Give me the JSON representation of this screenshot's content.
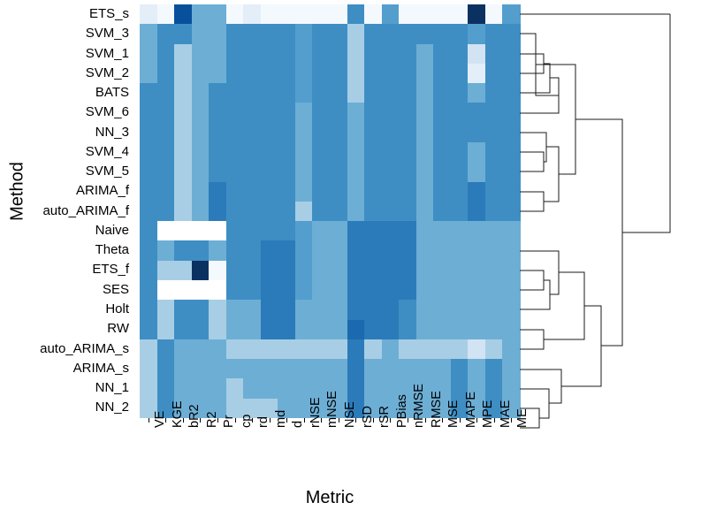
{
  "axes": {
    "y_title": "Method",
    "x_title": "Metric"
  },
  "chart_data": {
    "type": "heatmap",
    "title": "",
    "xlabel": "Metric",
    "ylabel": "Method",
    "grid": false,
    "legend": "none",
    "colorscale": {
      "name": "Blues",
      "stops": [
        "#f4f9fe",
        "#e3eef8",
        "#d2e3f3",
        "#a8cee5",
        "#8fc1de",
        "#6daed5",
        "#539ecd",
        "#3e8ec4",
        "#2b7bba",
        "#1b69af",
        "#08509b",
        "#0b3161"
      ],
      "na_color": "#ffffff"
    },
    "rows": [
      "ETS_s",
      "SVM_3",
      "SVM_1",
      "SVM_2",
      "BATS",
      "SVM_6",
      "NN_3",
      "SVM_4",
      "SVM_5",
      "ARIMA_f",
      "auto_ARIMA_f",
      "Naive",
      "Theta",
      "ETS_f",
      "SES",
      "Holt",
      "RW",
      "auto_ARIMA_s",
      "ARIMA_s",
      "NN_1",
      "NN_2"
    ],
    "columns": [
      "VE",
      "KGE",
      "bR2",
      "R2",
      "Pr",
      "cp",
      "rd",
      "md",
      "d",
      "rNSE",
      "mNSE",
      "NSE",
      "rSD",
      "rSR",
      "PBias",
      "nRMSE",
      "RMSE",
      "MSE",
      "MAPE",
      "MPE",
      "MAE",
      "ME"
    ],
    "cells": [
      [
        "#e3eef8",
        "#f4f9fe",
        "#08509b",
        "#6daed5",
        "#6daed5",
        "#f4f9fe",
        "#e3eef8",
        "#f4f9fe",
        "#f4f9fe",
        "#f4f9fe",
        "#f4f9fe",
        "#f4f9fe",
        "#3e8ec4",
        "#f4f9fe",
        "#539ecd",
        "#f4f9fe",
        "#f4f9fe",
        "#f4f9fe",
        "#f4f9fe",
        "#0b3161",
        "#f4f9fe",
        "#539ecd"
      ],
      [
        "#6daed5",
        "#3e8ec4",
        "#3e8ec4",
        "#6daed5",
        "#6daed5",
        "#3e8ec4",
        "#3e8ec4",
        "#3e8ec4",
        "#3e8ec4",
        "#539ecd",
        "#3e8ec4",
        "#3e8ec4",
        "#a8cee5",
        "#3e8ec4",
        "#3e8ec4",
        "#3e8ec4",
        "#3e8ec4",
        "#3e8ec4",
        "#3e8ec4",
        "#539ecd",
        "#3e8ec4",
        "#3e8ec4"
      ],
      [
        "#6daed5",
        "#3e8ec4",
        "#a8cee5",
        "#6daed5",
        "#6daed5",
        "#3e8ec4",
        "#3e8ec4",
        "#3e8ec4",
        "#3e8ec4",
        "#539ecd",
        "#3e8ec4",
        "#3e8ec4",
        "#a8cee5",
        "#3e8ec4",
        "#3e8ec4",
        "#3e8ec4",
        "#6daed5",
        "#3e8ec4",
        "#3e8ec4",
        "#d2e3f3",
        "#3e8ec4",
        "#3e8ec4"
      ],
      [
        "#6daed5",
        "#3e8ec4",
        "#a8cee5",
        "#6daed5",
        "#6daed5",
        "#3e8ec4",
        "#3e8ec4",
        "#3e8ec4",
        "#3e8ec4",
        "#539ecd",
        "#3e8ec4",
        "#3e8ec4",
        "#a8cee5",
        "#3e8ec4",
        "#3e8ec4",
        "#3e8ec4",
        "#6daed5",
        "#3e8ec4",
        "#3e8ec4",
        "#e3eef8",
        "#3e8ec4",
        "#3e8ec4"
      ],
      [
        "#3e8ec4",
        "#3e8ec4",
        "#a8cee5",
        "#6daed5",
        "#3e8ec4",
        "#3e8ec4",
        "#3e8ec4",
        "#3e8ec4",
        "#3e8ec4",
        "#539ecd",
        "#3e8ec4",
        "#3e8ec4",
        "#a8cee5",
        "#3e8ec4",
        "#3e8ec4",
        "#3e8ec4",
        "#6daed5",
        "#3e8ec4",
        "#3e8ec4",
        "#6daed5",
        "#3e8ec4",
        "#3e8ec4"
      ],
      [
        "#3e8ec4",
        "#3e8ec4",
        "#a8cee5",
        "#6daed5",
        "#3e8ec4",
        "#3e8ec4",
        "#3e8ec4",
        "#3e8ec4",
        "#3e8ec4",
        "#6daed5",
        "#3e8ec4",
        "#3e8ec4",
        "#6daed5",
        "#3e8ec4",
        "#3e8ec4",
        "#3e8ec4",
        "#6daed5",
        "#3e8ec4",
        "#3e8ec4",
        "#3e8ec4",
        "#3e8ec4",
        "#3e8ec4"
      ],
      [
        "#3e8ec4",
        "#3e8ec4",
        "#a8cee5",
        "#6daed5",
        "#3e8ec4",
        "#3e8ec4",
        "#3e8ec4",
        "#3e8ec4",
        "#3e8ec4",
        "#6daed5",
        "#3e8ec4",
        "#3e8ec4",
        "#6daed5",
        "#3e8ec4",
        "#3e8ec4",
        "#3e8ec4",
        "#6daed5",
        "#3e8ec4",
        "#3e8ec4",
        "#3e8ec4",
        "#3e8ec4",
        "#3e8ec4"
      ],
      [
        "#3e8ec4",
        "#3e8ec4",
        "#a8cee5",
        "#6daed5",
        "#3e8ec4",
        "#3e8ec4",
        "#3e8ec4",
        "#3e8ec4",
        "#3e8ec4",
        "#6daed5",
        "#3e8ec4",
        "#3e8ec4",
        "#6daed5",
        "#3e8ec4",
        "#3e8ec4",
        "#3e8ec4",
        "#6daed5",
        "#3e8ec4",
        "#3e8ec4",
        "#6daed5",
        "#3e8ec4",
        "#3e8ec4"
      ],
      [
        "#3e8ec4",
        "#3e8ec4",
        "#a8cee5",
        "#6daed5",
        "#3e8ec4",
        "#3e8ec4",
        "#3e8ec4",
        "#3e8ec4",
        "#3e8ec4",
        "#6daed5",
        "#3e8ec4",
        "#3e8ec4",
        "#6daed5",
        "#3e8ec4",
        "#3e8ec4",
        "#3e8ec4",
        "#6daed5",
        "#3e8ec4",
        "#3e8ec4",
        "#6daed5",
        "#3e8ec4",
        "#3e8ec4"
      ],
      [
        "#3e8ec4",
        "#3e8ec4",
        "#a8cee5",
        "#6daed5",
        "#2b7bba",
        "#3e8ec4",
        "#3e8ec4",
        "#3e8ec4",
        "#3e8ec4",
        "#6daed5",
        "#3e8ec4",
        "#3e8ec4",
        "#6daed5",
        "#3e8ec4",
        "#3e8ec4",
        "#3e8ec4",
        "#6daed5",
        "#3e8ec4",
        "#3e8ec4",
        "#2b7bba",
        "#3e8ec4",
        "#3e8ec4"
      ],
      [
        "#3e8ec4",
        "#3e8ec4",
        "#a8cee5",
        "#6daed5",
        "#2b7bba",
        "#3e8ec4",
        "#3e8ec4",
        "#3e8ec4",
        "#3e8ec4",
        "#a8cee5",
        "#3e8ec4",
        "#3e8ec4",
        "#6daed5",
        "#3e8ec4",
        "#3e8ec4",
        "#3e8ec4",
        "#6daed5",
        "#3e8ec4",
        "#3e8ec4",
        "#2b7bba",
        "#3e8ec4",
        "#3e8ec4"
      ],
      [
        "#3e8ec4",
        "#ffffff",
        "#ffffff",
        "#ffffff",
        "#ffffff",
        "#3e8ec4",
        "#3e8ec4",
        "#3e8ec4",
        "#3e8ec4",
        "#539ecd",
        "#6daed5",
        "#6daed5",
        "#2b7bba",
        "#2b7bba",
        "#2b7bba",
        "#2b7bba",
        "#6daed5",
        "#6daed5",
        "#6daed5",
        "#6daed5",
        "#6daed5",
        "#6daed5"
      ],
      [
        "#3e8ec4",
        "#6daed5",
        "#3e8ec4",
        "#3e8ec4",
        "#6daed5",
        "#3e8ec4",
        "#3e8ec4",
        "#2b7bba",
        "#2b7bba",
        "#539ecd",
        "#6daed5",
        "#6daed5",
        "#2b7bba",
        "#2b7bba",
        "#2b7bba",
        "#2b7bba",
        "#6daed5",
        "#6daed5",
        "#6daed5",
        "#6daed5",
        "#6daed5",
        "#6daed5"
      ],
      [
        "#3e8ec4",
        "#a8cee5",
        "#a8cee5",
        "#0b3161",
        "#f4f9fe",
        "#3e8ec4",
        "#3e8ec4",
        "#2b7bba",
        "#2b7bba",
        "#539ecd",
        "#6daed5",
        "#6daed5",
        "#2b7bba",
        "#2b7bba",
        "#2b7bba",
        "#2b7bba",
        "#6daed5",
        "#6daed5",
        "#6daed5",
        "#6daed5",
        "#6daed5",
        "#6daed5"
      ],
      [
        "#3e8ec4",
        "#ffffff",
        "#ffffff",
        "#ffffff",
        "#ffffff",
        "#3e8ec4",
        "#3e8ec4",
        "#2b7bba",
        "#2b7bba",
        "#539ecd",
        "#6daed5",
        "#6daed5",
        "#2b7bba",
        "#2b7bba",
        "#2b7bba",
        "#2b7bba",
        "#6daed5",
        "#6daed5",
        "#6daed5",
        "#6daed5",
        "#6daed5",
        "#6daed5"
      ],
      [
        "#3e8ec4",
        "#a8cee5",
        "#3e8ec4",
        "#3e8ec4",
        "#a8cee5",
        "#6daed5",
        "#6daed5",
        "#2b7bba",
        "#2b7bba",
        "#6daed5",
        "#6daed5",
        "#6daed5",
        "#2b7bba",
        "#2b7bba",
        "#2b7bba",
        "#3e8ec4",
        "#6daed5",
        "#6daed5",
        "#6daed5",
        "#6daed5",
        "#6daed5",
        "#6daed5"
      ],
      [
        "#3e8ec4",
        "#a8cee5",
        "#3e8ec4",
        "#3e8ec4",
        "#a8cee5",
        "#6daed5",
        "#6daed5",
        "#2b7bba",
        "#2b7bba",
        "#6daed5",
        "#6daed5",
        "#6daed5",
        "#1b69af",
        "#2b7bba",
        "#2b7bba",
        "#3e8ec4",
        "#6daed5",
        "#6daed5",
        "#6daed5",
        "#6daed5",
        "#6daed5",
        "#6daed5"
      ],
      [
        "#a8cee5",
        "#3e8ec4",
        "#6daed5",
        "#6daed5",
        "#6daed5",
        "#a8cee5",
        "#a8cee5",
        "#a8cee5",
        "#a8cee5",
        "#a8cee5",
        "#a8cee5",
        "#a8cee5",
        "#2b7bba",
        "#a8cee5",
        "#6daed5",
        "#a8cee5",
        "#a8cee5",
        "#a8cee5",
        "#a8cee5",
        "#d2e3f3",
        "#a8cee5",
        "#6daed5"
      ],
      [
        "#a8cee5",
        "#3e8ec4",
        "#6daed5",
        "#6daed5",
        "#6daed5",
        "#6daed5",
        "#6daed5",
        "#6daed5",
        "#6daed5",
        "#6daed5",
        "#6daed5",
        "#6daed5",
        "#2b7bba",
        "#6daed5",
        "#6daed5",
        "#6daed5",
        "#6daed5",
        "#6daed5",
        "#3e8ec4",
        "#6daed5",
        "#3e8ec4",
        "#6daed5"
      ],
      [
        "#a8cee5",
        "#3e8ec4",
        "#6daed5",
        "#6daed5",
        "#6daed5",
        "#a8cee5",
        "#6daed5",
        "#6daed5",
        "#6daed5",
        "#6daed5",
        "#6daed5",
        "#6daed5",
        "#2b7bba",
        "#6daed5",
        "#6daed5",
        "#6daed5",
        "#6daed5",
        "#6daed5",
        "#3e8ec4",
        "#6daed5",
        "#3e8ec4",
        "#6daed5"
      ],
      [
        "#a8cee5",
        "#3e8ec4",
        "#6daed5",
        "#6daed5",
        "#6daed5",
        "#a8cee5",
        "#a8cee5",
        "#a8cee5",
        "#6daed5",
        "#6daed5",
        "#6daed5",
        "#6daed5",
        "#2b7bba",
        "#6daed5",
        "#6daed5",
        "#6daed5",
        "#6daed5",
        "#6daed5",
        "#3e8ec4",
        "#6daed5",
        "#3e8ec4",
        "#6daed5"
      ]
    ]
  },
  "dendrogram": {
    "orientation": "right",
    "line_color": "#1a1a1a"
  }
}
